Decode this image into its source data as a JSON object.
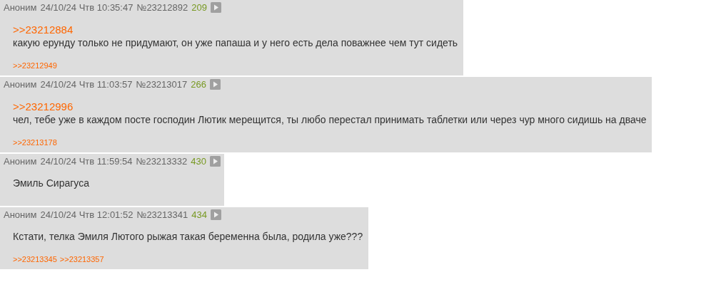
{
  "posts": [
    {
      "author": "Аноним",
      "date": "24/10/24 Чтв 10:35:47",
      "number": "№23212892",
      "ordinal": "209",
      "body": [
        {
          "kind": "reply-link",
          "text": ">>23212884"
        },
        {
          "kind": "text",
          "text": "какую ерунду только не придумают, он уже папаша и у него есть дела поважнее чем тут сидеть"
        }
      ],
      "replies": [
        ">>23212949"
      ]
    },
    {
      "author": "Аноним",
      "date": "24/10/24 Чтв 11:03:57",
      "number": "№23213017",
      "ordinal": "266",
      "body": [
        {
          "kind": "reply-link",
          "text": ">>23212996"
        },
        {
          "kind": "text",
          "text": "чел, тебе уже в каждом посте господин Лютик мерещится, ты любо перестал принимать таблетки или через чур много сидишь на дваче"
        }
      ],
      "replies": [
        ">>23213178"
      ]
    },
    {
      "author": "Аноним",
      "date": "24/10/24 Чтв 11:59:54",
      "number": "№23213332",
      "ordinal": "430",
      "body": [
        {
          "kind": "text",
          "text": "Эмиль Сирагуса"
        }
      ]
    },
    {
      "author": "Аноним",
      "date": "24/10/24 Чтв 12:01:52",
      "number": "№23213341",
      "ordinal": "434",
      "body": [
        {
          "kind": "text",
          "text": "Кстати, телка Эмиля Лютого рыжая такая беременна была, родила уже???"
        }
      ],
      "replies": [
        ">>23213345",
        ">>23213357"
      ]
    }
  ]
}
